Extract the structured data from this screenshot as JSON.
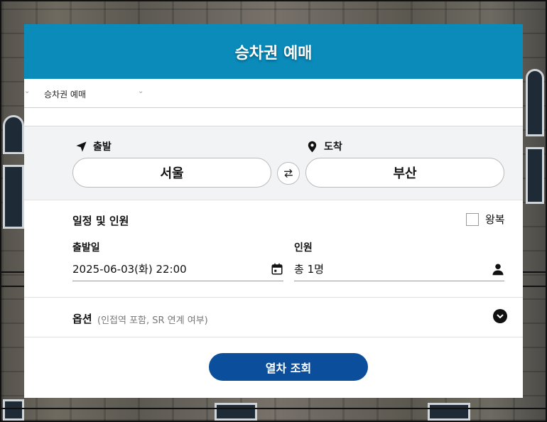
{
  "header": {
    "title": "승차권 예매"
  },
  "tabbar": {
    "selected": "승차권 예매"
  },
  "route": {
    "departure_label": "출발",
    "arrival_label": "도착",
    "departure_station": "서울",
    "arrival_station": "부산",
    "swap_icon": "swap-icon"
  },
  "schedule": {
    "title": "일정 및 인원",
    "roundtrip_label": "왕복",
    "roundtrip_checked": false,
    "date_label": "출발일",
    "date_value": "2025-06-03(화) 22:00",
    "people_label": "인원",
    "people_value": "총 1명"
  },
  "options": {
    "title": "옵션",
    "description": "(인접역 포함, SR 연계 여부)"
  },
  "search": {
    "button_label": "열차 조회"
  },
  "colors": {
    "header": "#0a8bba",
    "button": "#0b4f9c"
  }
}
